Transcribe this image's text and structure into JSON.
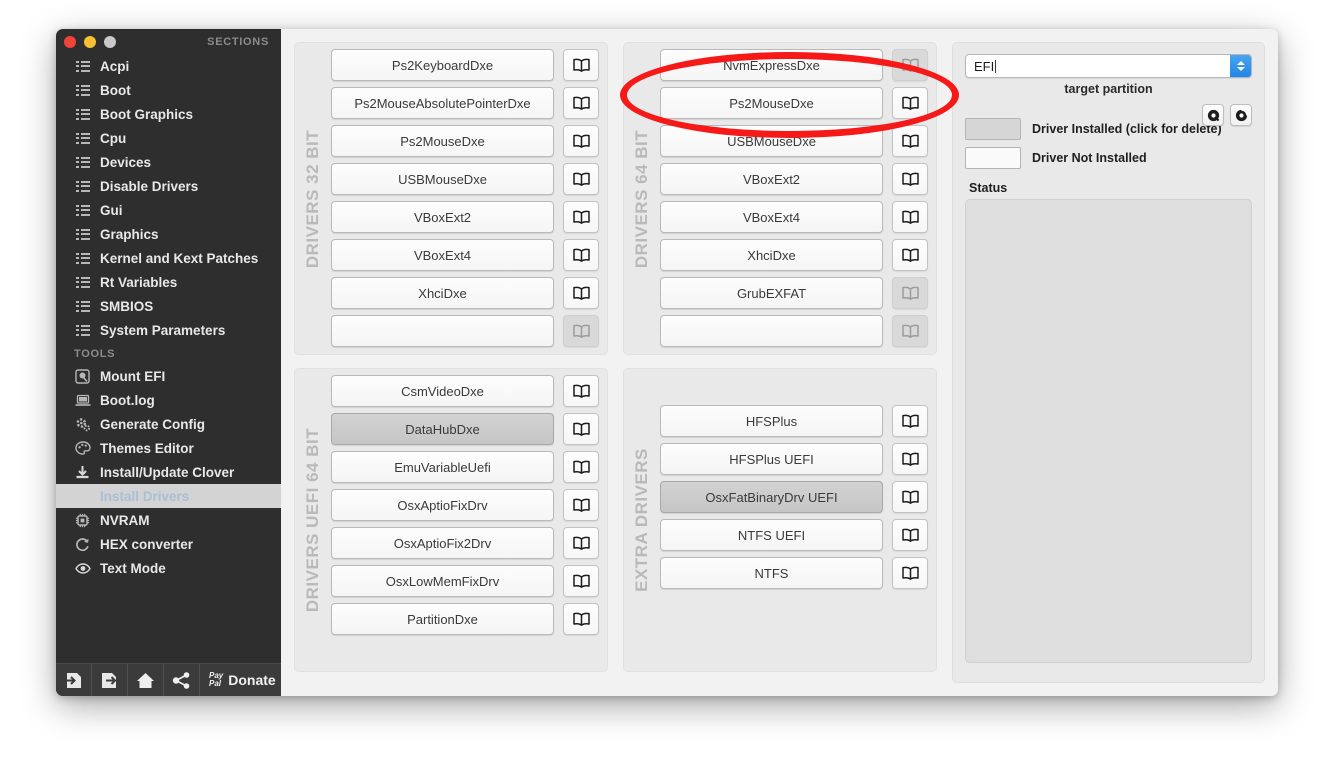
{
  "window": {
    "traffic_lights": [
      "close",
      "minimize",
      "zoom"
    ],
    "sections_caption": "SECTIONS",
    "tools_caption": "TOOLS"
  },
  "sidebar": {
    "sections": [
      {
        "label": "Acpi",
        "icon": "list-grid-icon"
      },
      {
        "label": "Boot",
        "icon": "list-grid-icon"
      },
      {
        "label": "Boot Graphics",
        "icon": "list-grid-icon"
      },
      {
        "label": "Cpu",
        "icon": "list-grid-icon"
      },
      {
        "label": "Devices",
        "icon": "list-grid-icon"
      },
      {
        "label": "Disable Drivers",
        "icon": "list-grid-icon"
      },
      {
        "label": "Gui",
        "icon": "list-grid-icon"
      },
      {
        "label": "Graphics",
        "icon": "list-grid-icon"
      },
      {
        "label": "Kernel and Kext Patches",
        "icon": "list-grid-icon"
      },
      {
        "label": "Rt Variables",
        "icon": "list-grid-icon"
      },
      {
        "label": "SMBIOS",
        "icon": "list-grid-icon"
      },
      {
        "label": "System Parameters",
        "icon": "list-grid-icon"
      }
    ],
    "tools": [
      {
        "label": "Mount EFI",
        "icon": "disk-icon",
        "selected": false
      },
      {
        "label": "Boot.log",
        "icon": "laptop-icon",
        "selected": false
      },
      {
        "label": "Generate Config",
        "icon": "gears-icon",
        "selected": false
      },
      {
        "label": "Themes Editor",
        "icon": "palette-icon",
        "selected": false
      },
      {
        "label": "Install/Update Clover",
        "icon": "download-icon",
        "selected": false
      },
      {
        "label": "Install Drivers",
        "icon": "none",
        "selected": true
      },
      {
        "label": "NVRAM",
        "icon": "chip-icon",
        "selected": false
      },
      {
        "label": "HEX converter",
        "icon": "refresh-icon",
        "selected": false
      },
      {
        "label": "Text Mode",
        "icon": "eye-icon",
        "selected": false
      }
    ],
    "toolbar": {
      "import_icon": "arrow-into-page-icon",
      "export_icon": "arrow-out-of-page-icon",
      "home_icon": "home-icon",
      "share_icon": "share-icon",
      "paypal_line1": "Pay",
      "paypal_line2": "Pal",
      "donate_label": "Donate"
    }
  },
  "panels": {
    "drivers32": {
      "title": "DRIVERS 32 BIT",
      "rows": [
        {
          "name": "Ps2KeyboardDxe",
          "installed": false,
          "book_dim": false
        },
        {
          "name": "Ps2MouseAbsolutePointerDxe",
          "installed": false,
          "book_dim": false
        },
        {
          "name": "Ps2MouseDxe",
          "installed": false,
          "book_dim": false
        },
        {
          "name": "USBMouseDxe",
          "installed": false,
          "book_dim": false
        },
        {
          "name": "VBoxExt2",
          "installed": false,
          "book_dim": false
        },
        {
          "name": "VBoxExt4",
          "installed": false,
          "book_dim": false
        },
        {
          "name": "XhciDxe",
          "installed": false,
          "book_dim": false
        },
        {
          "name": "",
          "installed": false,
          "book_dim": true
        }
      ]
    },
    "drivers64": {
      "title": "DRIVERS 64 BIT",
      "rows": [
        {
          "name": "NvmExpressDxe",
          "installed": false,
          "book_dim": true
        },
        {
          "name": "Ps2MouseDxe",
          "installed": false,
          "book_dim": false
        },
        {
          "name": "USBMouseDxe",
          "installed": false,
          "book_dim": false
        },
        {
          "name": "VBoxExt2",
          "installed": false,
          "book_dim": false
        },
        {
          "name": "VBoxExt4",
          "installed": false,
          "book_dim": false
        },
        {
          "name": "XhciDxe",
          "installed": false,
          "book_dim": false
        },
        {
          "name": "GrubEXFAT",
          "installed": false,
          "book_dim": true
        },
        {
          "name": "",
          "installed": false,
          "book_dim": true
        }
      ]
    },
    "uefi64": {
      "title": "DRIVERS UEFI 64 BIT",
      "rows": [
        {
          "name": "CsmVideoDxe",
          "installed": false,
          "book_dim": false
        },
        {
          "name": "DataHubDxe",
          "installed": true,
          "book_dim": false
        },
        {
          "name": "EmuVariableUefi",
          "installed": false,
          "book_dim": false
        },
        {
          "name": "OsxAptioFixDrv",
          "installed": false,
          "book_dim": false
        },
        {
          "name": "OsxAptioFix2Drv",
          "installed": false,
          "book_dim": false
        },
        {
          "name": "OsxLowMemFixDrv",
          "installed": false,
          "book_dim": false
        },
        {
          "name": "PartitionDxe",
          "installed": false,
          "book_dim": false
        }
      ]
    },
    "extra": {
      "title": "EXTRA DRIVERS",
      "rows": [
        {
          "name": "HFSPlus",
          "installed": false,
          "book_dim": false
        },
        {
          "name": "HFSPlus UEFI",
          "installed": false,
          "book_dim": false
        },
        {
          "name": "OsxFatBinaryDrv UEFI",
          "installed": true,
          "book_dim": false
        },
        {
          "name": "NTFS UEFI",
          "installed": false,
          "book_dim": false
        },
        {
          "name": "NTFS",
          "installed": false,
          "book_dim": false
        }
      ]
    }
  },
  "right": {
    "partition_value": "EFI",
    "partition_caption": "target partition",
    "button_a_icon": "mount-disc-icon",
    "button_b_icon": "unmount-disc-icon",
    "legend_installed": "Driver Installed (click for delete)",
    "legend_not_installed": "Driver Not Installed",
    "status_caption": "Status",
    "status_text": ""
  },
  "annotation": {
    "shape": "ellipse",
    "color": "#f51a18",
    "targets": "NvmExpressDxe"
  }
}
